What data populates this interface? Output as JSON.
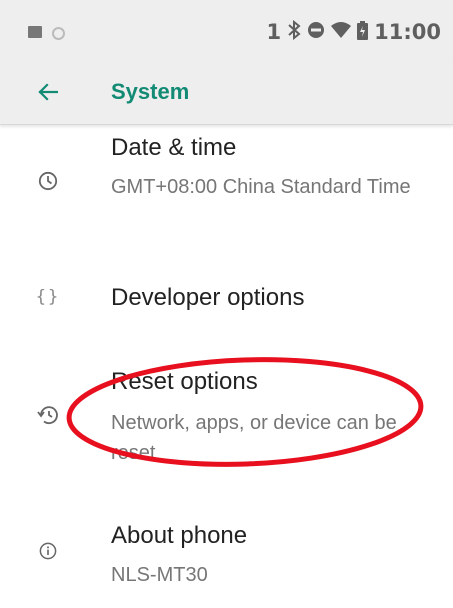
{
  "status_bar": {
    "left_icons": [
      "image-icon",
      "circle-icon"
    ],
    "notification_count": "1",
    "right_icons": [
      "bluetooth-icon",
      "do-not-disturb-icon",
      "wifi-icon",
      "battery-icon"
    ],
    "time": "11:00"
  },
  "app_bar": {
    "back_icon": "arrow-back-icon",
    "title": "System",
    "accent_color": "#128a74"
  },
  "items": [
    {
      "icon": "clock-icon",
      "title": "Date & time",
      "summary": "GMT+08:00 China Standard Time"
    },
    {
      "icon": "braces-icon",
      "title": "Developer options",
      "summary": ""
    },
    {
      "icon": "history-icon",
      "title": "Reset options",
      "summary": "Network, apps, or device can be reset"
    },
    {
      "icon": "info-icon",
      "title": "About phone",
      "summary": "NLS-MT30"
    }
  ],
  "annotation": {
    "shape": "ellipse",
    "color": "#e8101e",
    "target": "Reset options"
  }
}
